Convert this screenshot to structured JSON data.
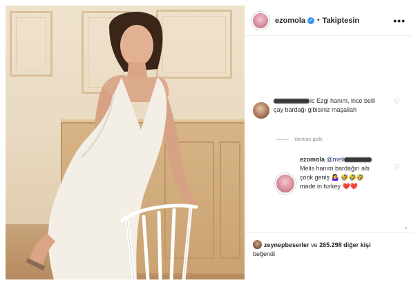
{
  "header": {
    "username": "ezomola",
    "verified_icon": "verified-badge-icon",
    "separator": "•",
    "follow_status": "Takiptesin",
    "more_icon": "•••"
  },
  "comments": [
    {
      "username_visible_suffix": "ic Ezgi hanım, ince belli",
      "text_line2": "çay bardağı gibisiniz maşallah",
      "like_icon": "heart-outline-icon"
    },
    {
      "username": "ezomola",
      "mention_prefix": "@meli",
      "line1": "Melis hanım bardağın altı",
      "line2": "çook geniş 🤷‍♀️ 🤣🤣🤣",
      "line3": "made in turkey ❤️❤️",
      "like_icon": "heart-outline-icon"
    }
  ],
  "replies_toggle": "Yanıtları gizle",
  "likes": {
    "first_liker": "zeynepbeserler",
    "connector": " ve ",
    "count_text": "265.298 diğer kişi",
    "suffix": "beğendi"
  },
  "colors": {
    "verified": "#3897f0",
    "text": "#262626",
    "muted": "#8e8e8e"
  }
}
